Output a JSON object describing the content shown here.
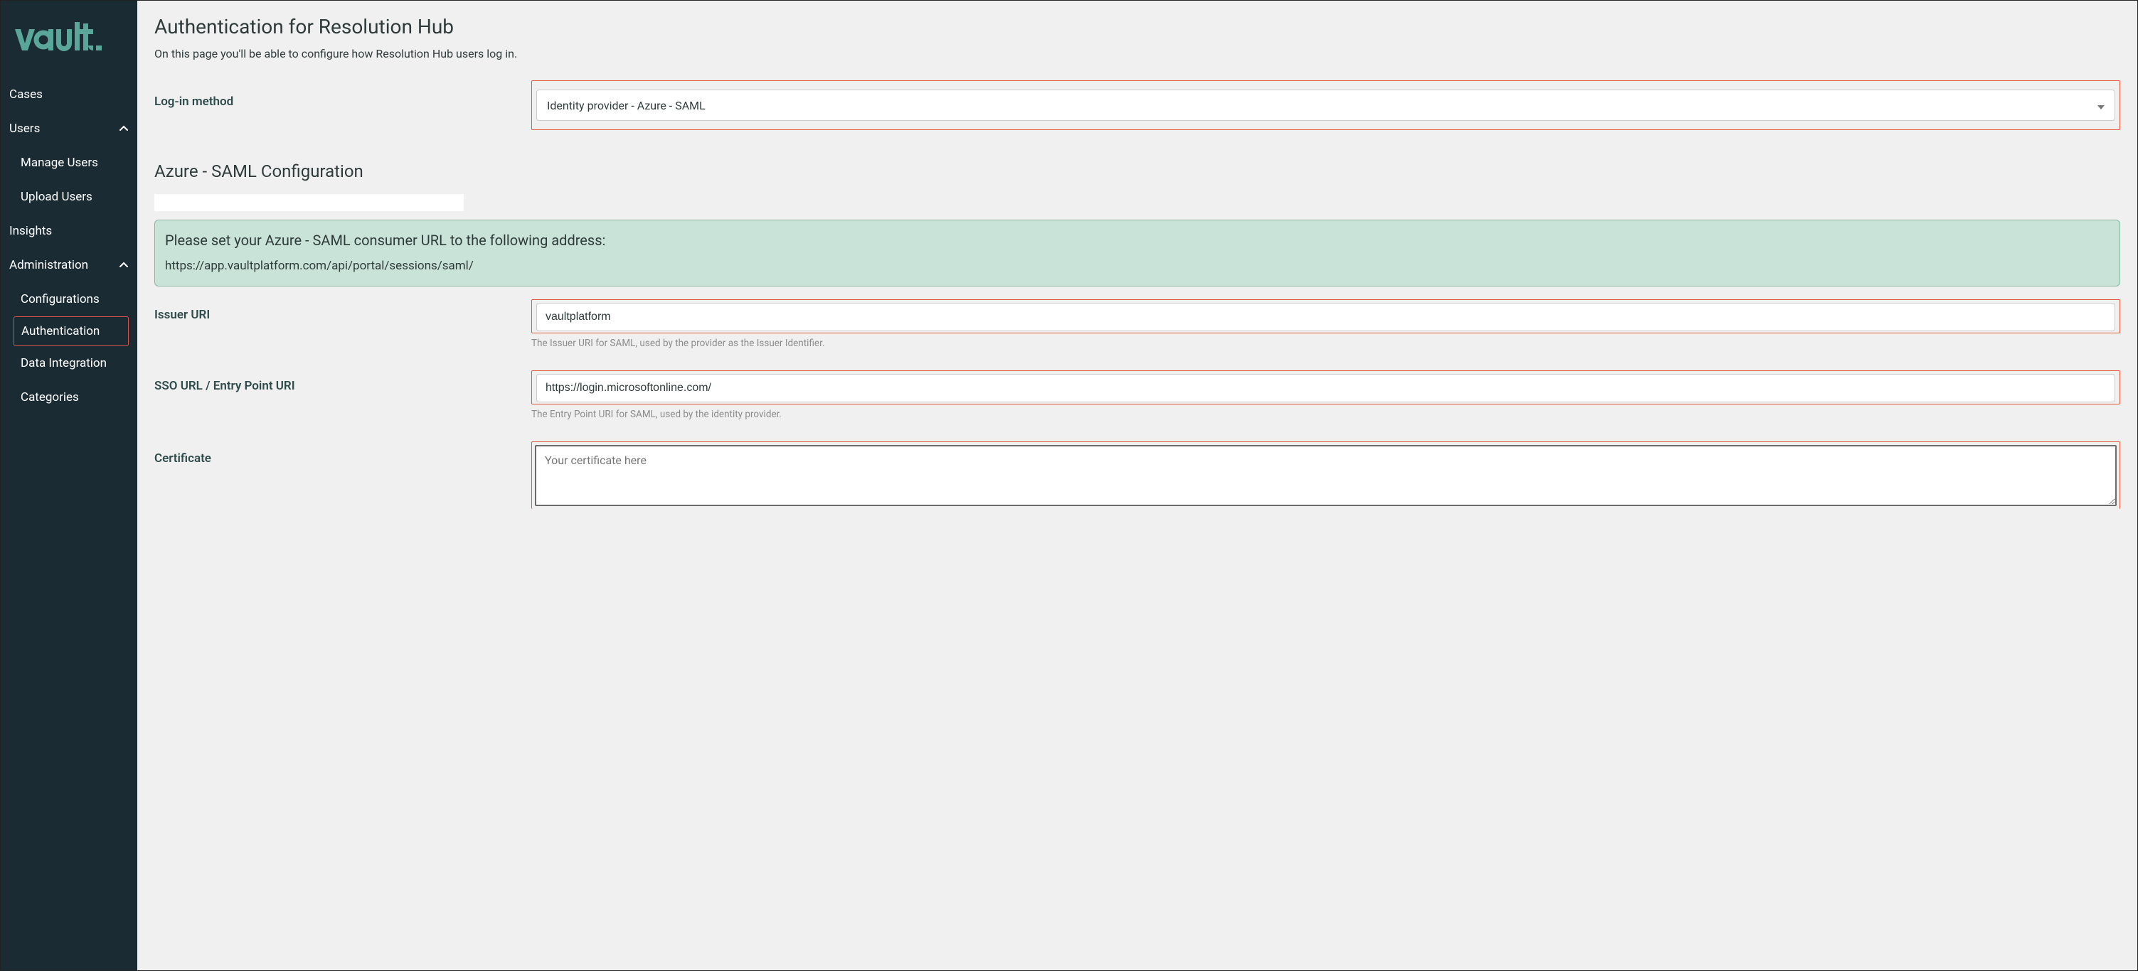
{
  "brand": {
    "name": "vault."
  },
  "sidebar": {
    "items": [
      {
        "label": "Cases",
        "expandable": false
      },
      {
        "label": "Users",
        "expandable": true,
        "expanded": true
      },
      {
        "label": "Manage Users",
        "sub": true
      },
      {
        "label": "Upload Users",
        "sub": true
      },
      {
        "label": "Insights",
        "expandable": false
      },
      {
        "label": "Administration",
        "expandable": true,
        "expanded": true
      },
      {
        "label": "Configurations",
        "sub": true
      },
      {
        "label": "Authentication",
        "sub": true,
        "active": true
      },
      {
        "label": "Data Integration",
        "sub": true
      },
      {
        "label": "Categories",
        "sub": true
      }
    ]
  },
  "page": {
    "title": "Authentication for Resolution Hub",
    "description": "On this page you'll be able to configure how Resolution Hub users log in."
  },
  "form": {
    "login_method": {
      "label": "Log-in method",
      "value": "Identity provider - Azure - SAML"
    },
    "section_title": "Azure - SAML Configuration",
    "info": {
      "title": "Please set your Azure - SAML consumer URL to the following address:",
      "url": "https://app.vaultplatform.com/api/portal/sessions/saml/"
    },
    "issuer": {
      "label": "Issuer URI",
      "value": "vaultplatform",
      "help": "The Issuer URI for SAML, used by the provider as the Issuer Identifier."
    },
    "sso": {
      "label": "SSO URL / Entry Point URI",
      "value": "https://login.microsoftonline.com/",
      "help": "The Entry Point URI for SAML, used by the identity provider."
    },
    "cert": {
      "label": "Certificate",
      "placeholder": "Your certificate here"
    }
  },
  "colors": {
    "sidebar_bg": "#1a2b33",
    "accent": "#5aa79a",
    "highlight": "#e05a3a",
    "info_bg": "#c9e3d8"
  }
}
